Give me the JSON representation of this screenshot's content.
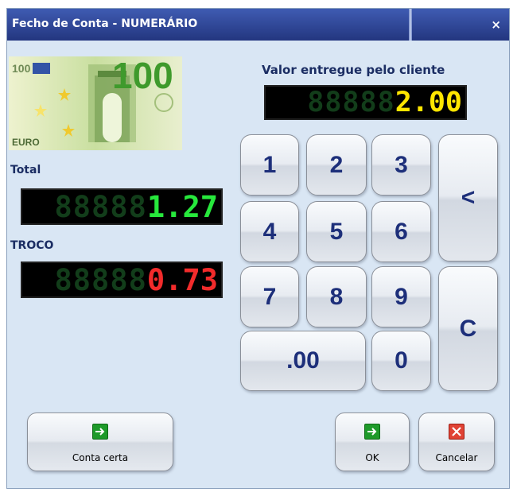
{
  "window": {
    "title": "Fecho de Conta - NUMERÁRIO",
    "close_label": "×"
  },
  "valor": {
    "label": "Valor entregue pelo cliente",
    "display": "2.00",
    "color": "#ffe600"
  },
  "total": {
    "label": "Total",
    "display": "1.27",
    "color": "#27e83c"
  },
  "troco": {
    "label": "TROCO",
    "display": "0.73",
    "color": "#f22b2b"
  },
  "banknote": {
    "denomination": "100",
    "currency": "EURO"
  },
  "keypad": {
    "k1": "1",
    "k2": "2",
    "k3": "3",
    "k4": "4",
    "k5": "5",
    "k6": "6",
    "k7": "7",
    "k8": "8",
    "k9": "9",
    "kdot": ".00",
    "k0": "0",
    "backspace": "<",
    "clear": "C"
  },
  "buttons": {
    "conta_certa": "Conta certa",
    "ok": "OK",
    "cancelar": "Cancelar"
  }
}
